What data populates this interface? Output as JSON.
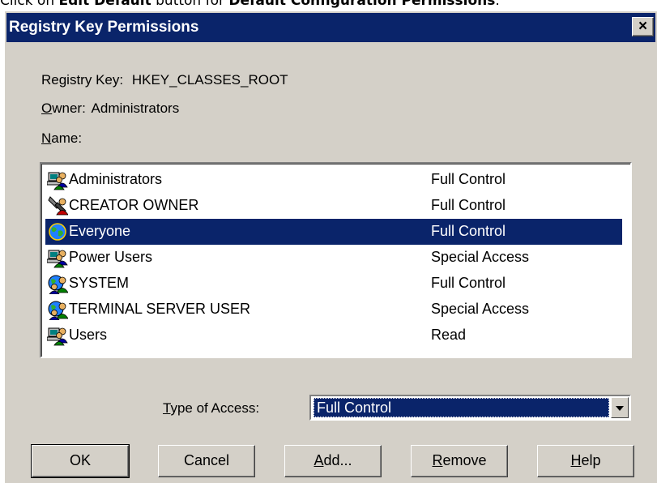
{
  "caption": {
    "prefix": "Click on ",
    "bold1": "Edit Default",
    "middle": " button for ",
    "bold2": "Default Configuration Permissions",
    "suffix": "."
  },
  "dialog": {
    "title": "Registry Key Permissions",
    "close_label": "×"
  },
  "info": {
    "registry_key_label": "Registry Key:",
    "registry_key_value": "HKEY_CLASSES_ROOT",
    "owner_label_access": "O",
    "owner_label_rest": "wner:",
    "owner_value": "Administrators",
    "name_label_access": "N",
    "name_label_rest": "ame:"
  },
  "entries": [
    {
      "name": "Administrators",
      "access": "Full Control",
      "icon": "group-icon"
    },
    {
      "name": "CREATOR OWNER",
      "access": "Full Control",
      "icon": "creator-owner-icon"
    },
    {
      "name": "Everyone",
      "access": "Full Control",
      "icon": "globe-icon"
    },
    {
      "name": "Power Users",
      "access": "Special Access",
      "icon": "group-icon"
    },
    {
      "name": "SYSTEM",
      "access": "Full Control",
      "icon": "system-group-icon"
    },
    {
      "name": "TERMINAL SERVER USER",
      "access": "Special Access",
      "icon": "system-group-icon"
    },
    {
      "name": "Users",
      "access": "Read",
      "icon": "group-icon"
    }
  ],
  "type_of_access": {
    "label_access": "T",
    "label_rest": "ype of Access:",
    "value": "Full Control"
  },
  "buttons": {
    "ok": "OK",
    "cancel": "Cancel",
    "add_access": "A",
    "add_rest": "dd...",
    "remove_access": "R",
    "remove_rest": "emove",
    "help_access": "H",
    "help_rest": "elp"
  },
  "colors": {
    "face": "#d4d0c8",
    "title_bar": "#0a246a",
    "selection": "#0a246a"
  }
}
